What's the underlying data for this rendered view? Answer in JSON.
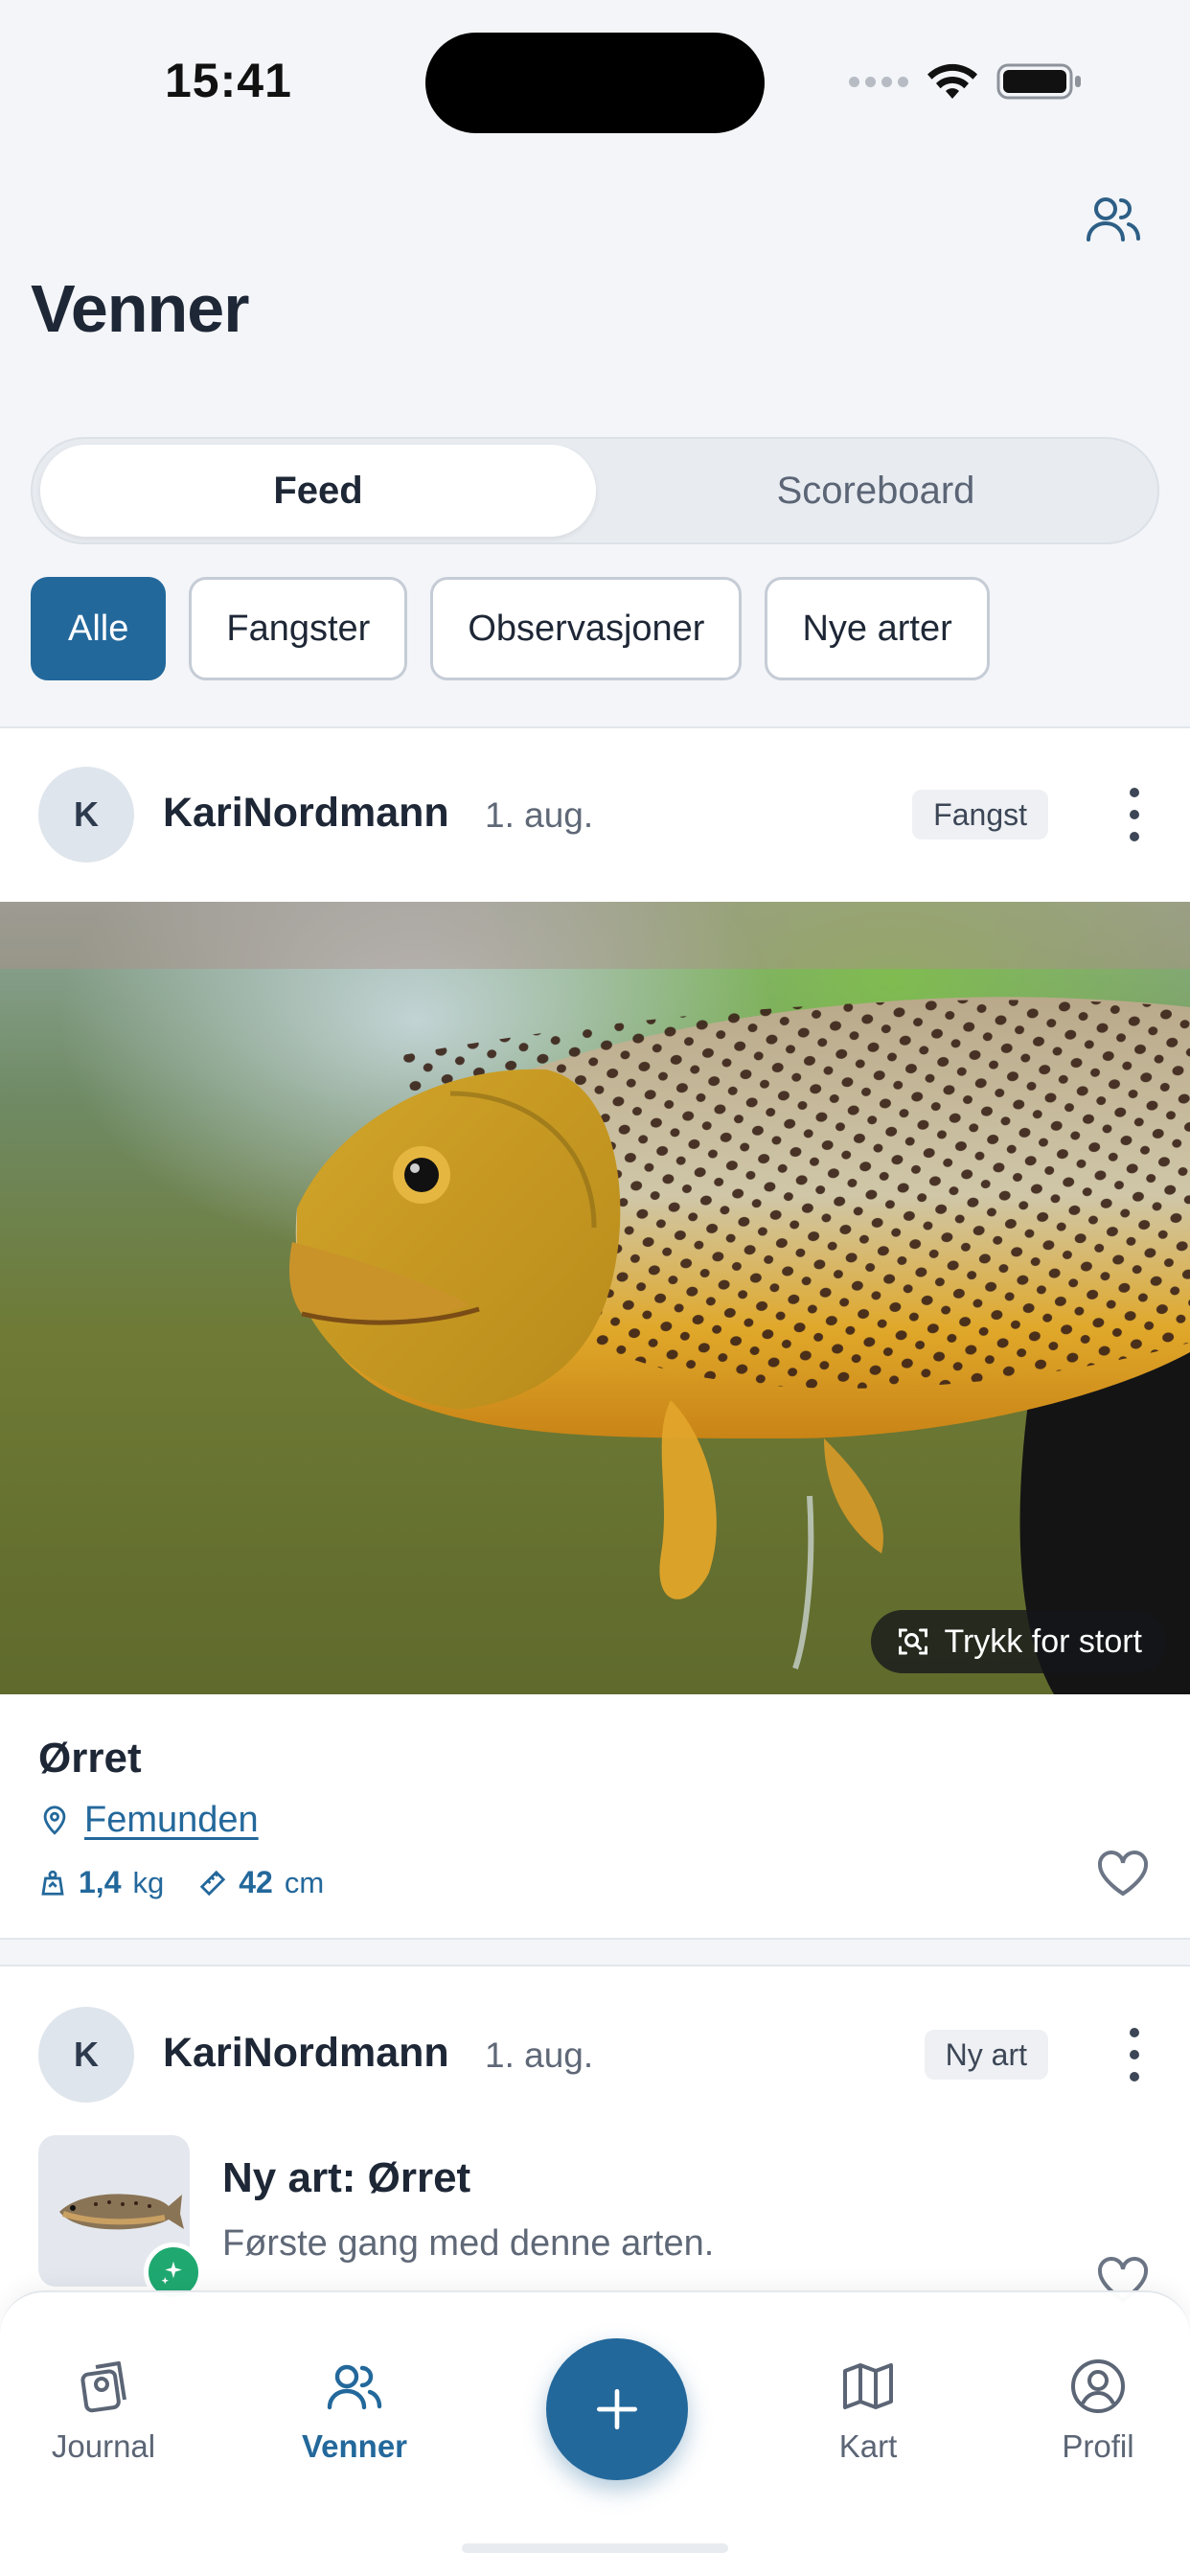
{
  "status": {
    "time": "15:41"
  },
  "header": {
    "title": "Venner",
    "friends_icon": "user-group-icon"
  },
  "segmented": {
    "feed": "Feed",
    "scoreboard": "Scoreboard",
    "selected": "Feed"
  },
  "filters": {
    "items": [
      "Alle",
      "Fangster",
      "Observasjoner",
      "Nye arter"
    ],
    "selected": "Alle"
  },
  "posts": [
    {
      "avatar_initial": "K",
      "username": "KariNordmann",
      "date": "1. aug.",
      "tag": "Fangst",
      "image_hint": "Trykk for stort",
      "species": "Ørret",
      "location": "Femunden",
      "weight_value": "1,4",
      "weight_unit": "kg",
      "length_value": "42",
      "length_unit": "cm"
    },
    {
      "avatar_initial": "K",
      "username": "KariNordmann",
      "date": "1. aug.",
      "tag": "Ny art",
      "title": "Ny art: Ørret",
      "subtitle": "Første gang med denne arten."
    }
  ],
  "tabbar": {
    "items": [
      {
        "label": "Journal",
        "icon": "journal-icon"
      },
      {
        "label": "Venner",
        "icon": "friends-icon"
      },
      {
        "label": "Kart",
        "icon": "map-icon"
      },
      {
        "label": "Profil",
        "icon": "profile-icon"
      }
    ],
    "active": "Venner",
    "add_icon": "plus-icon"
  },
  "colors": {
    "accent": "#23689b",
    "success": "#1fa971",
    "background": "#f3f5f8"
  }
}
